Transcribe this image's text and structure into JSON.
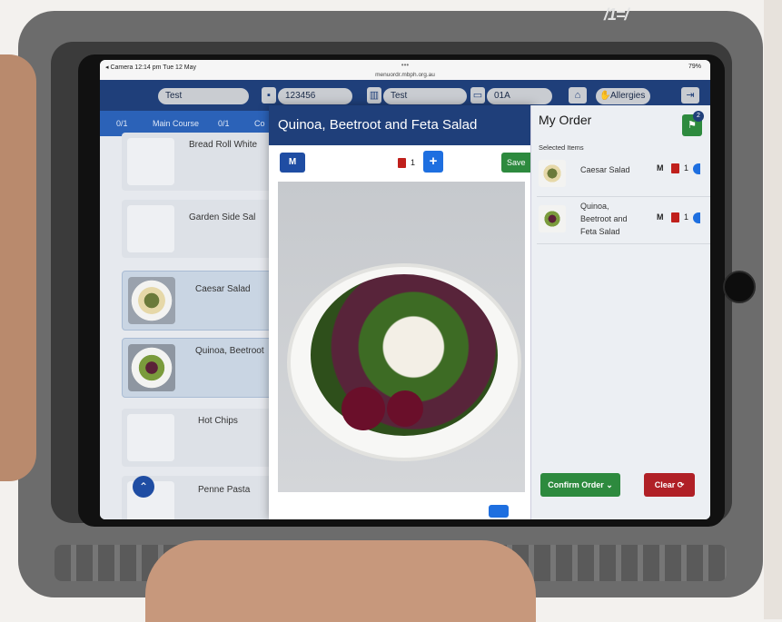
{
  "case_label": "/1=/",
  "status": {
    "left": "◂ Camera  12:14 pm  Tue 12 May",
    "dots": "•••",
    "url": "menuordr.mbph.org.au",
    "battery": "79%"
  },
  "topbar": {
    "name_value": "Test",
    "id_value": "123456",
    "ward_value": "Test",
    "bed_value": "01A",
    "allergies_label": "Allergies"
  },
  "tabs": [
    {
      "label": "0/1"
    },
    {
      "label": "Main Course"
    },
    {
      "label": "0/1"
    },
    {
      "label": "Co"
    }
  ],
  "menu_items": [
    {
      "label": "Bread Roll White"
    },
    {
      "label": "Garden Side Sal"
    },
    {
      "label": "Caesar Salad"
    },
    {
      "label": "Quinoa, Beetroot"
    },
    {
      "label": "Hot Chips"
    },
    {
      "label": "Penne Pasta"
    }
  ],
  "modal": {
    "title": "Quinoa, Beetroot and Feta Salad",
    "size_label": "M",
    "quantity": "1",
    "plus_label": "+",
    "save_label": "Save"
  },
  "order": {
    "title": "My Order",
    "cart_count": "2",
    "selected_items_label": "Selected Items",
    "items": [
      {
        "name": "Caesar Salad",
        "size": "M",
        "qty": "1"
      },
      {
        "name": "Quinoa, Beetroot and Feta Salad",
        "size": "M",
        "qty": "1"
      }
    ],
    "confirm_label": "Confirm Order",
    "clear_label": "Clear"
  },
  "colors": {
    "header_navy": "#1f3f7a",
    "tab_blue": "#2b62b8",
    "confirm_green": "#2d8a3e",
    "clear_red": "#b02026"
  },
  "icons": [
    "home-icon",
    "hand-icon",
    "logout-icon",
    "trash-icon",
    "cart-icon",
    "chevron-up-icon",
    "person-icon",
    "bed-icon"
  ]
}
